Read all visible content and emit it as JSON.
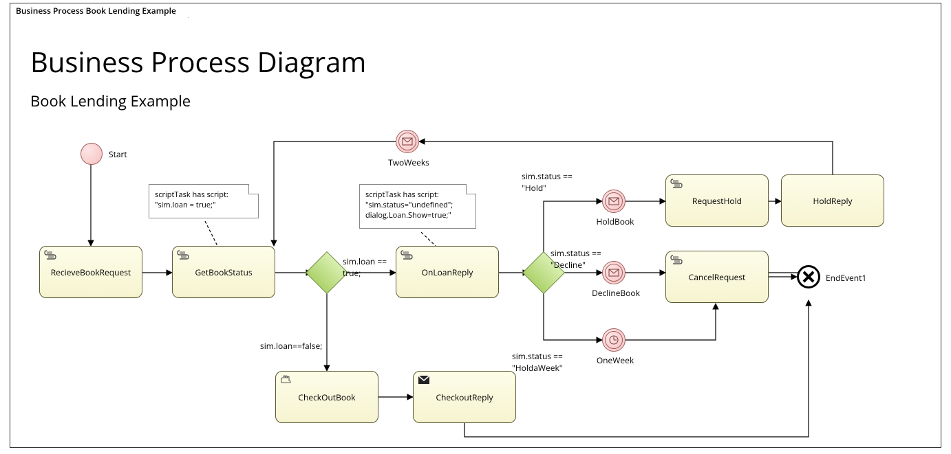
{
  "frame_title": "Business Process Book Lending Example",
  "heading": "Business Process Diagram",
  "subheading": "Book Lending Example",
  "events": {
    "start": "Start",
    "twoweeks": "TwoWeeks",
    "holdbook": "HoldBook",
    "declinebook": "DeclineBook",
    "oneweek": "OneWeek",
    "end": "EndEvent1"
  },
  "tasks": {
    "recieve": "RecieveBookRequest",
    "getstatus": "GetBookStatus",
    "onloanreply": "OnLoanReply",
    "checkoutbook": "CheckOutBook",
    "checkoutreply": "CheckoutReply",
    "requesthold": "RequestHold",
    "holdreply": "HoldReply",
    "cancelrequest": "CancelRequest"
  },
  "notes": {
    "n1_l1": "scriptTask has script:",
    "n1_l2": "\"sim.loan = true;\"",
    "n2_l1": "scriptTask has script:",
    "n2_l2": "\"sim.status=\"undefined\";",
    "n2_l3": "dialog.Loan.Show=true;\""
  },
  "guards": {
    "loan_true": "sim.loan ==\ntrue;",
    "loan_false": "sim.loan==false;",
    "status_hold": "sim.status ==\n\"Hold\"",
    "status_decline": "sim.status ==\n\"Decline\"",
    "status_holdaweek": "sim.status ==\n\"HoldaWeek\""
  }
}
